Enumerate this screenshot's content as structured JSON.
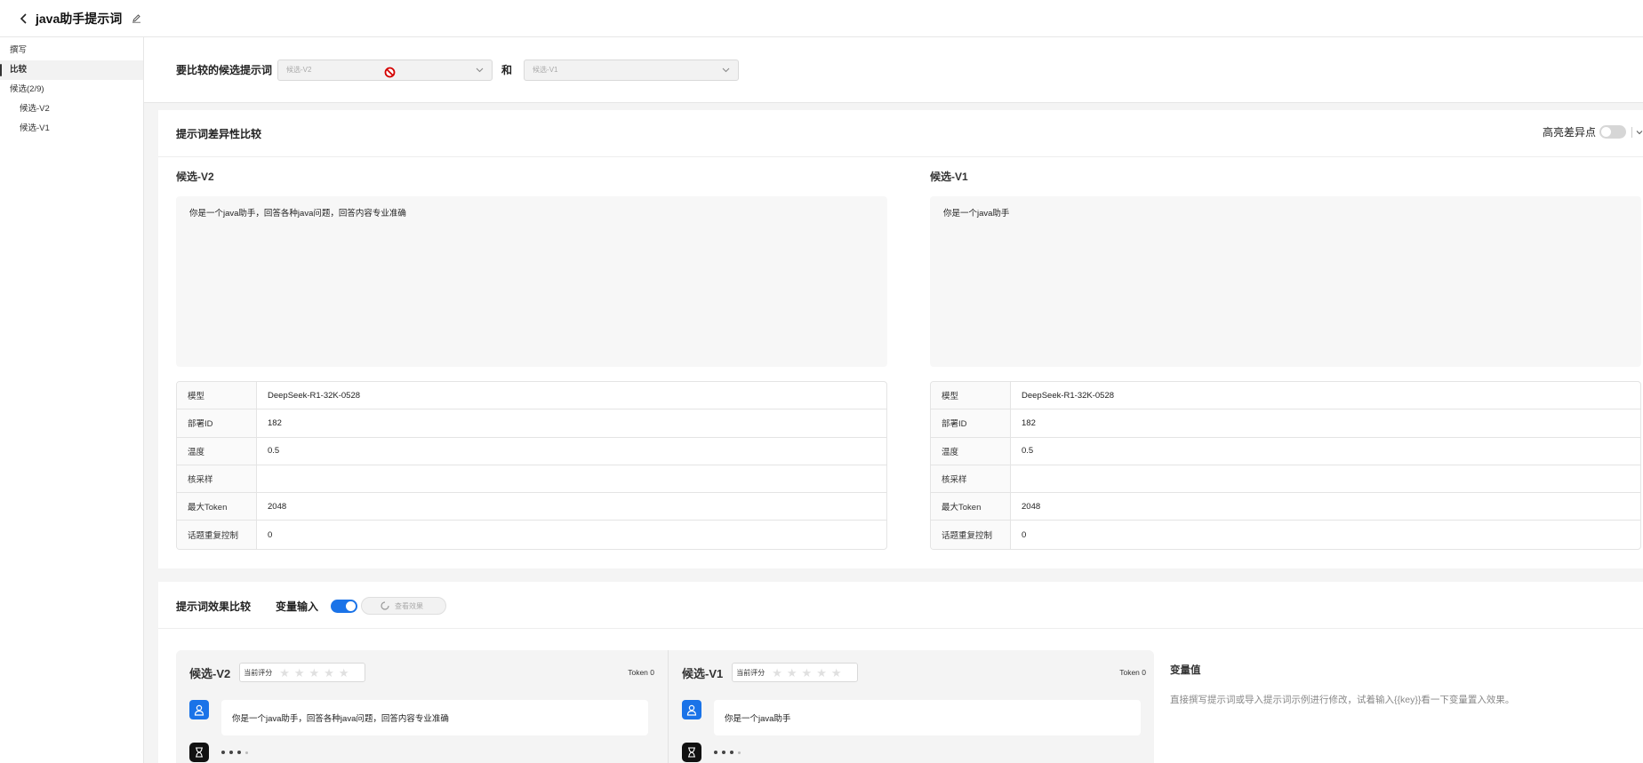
{
  "header": {
    "title": "java助手提示词"
  },
  "sidebar": {
    "items": [
      {
        "label": "撰写"
      },
      {
        "label": "比较"
      },
      {
        "label": "候选(2/9)"
      },
      {
        "label": "候选-V2"
      },
      {
        "label": "候选-V1"
      }
    ],
    "active_index": 1
  },
  "compare_bar": {
    "label": "要比较的候选提示词",
    "select_a": {
      "placeholder": "候选-V2"
    },
    "and_label": "和",
    "select_b": {
      "placeholder": "候选-V1"
    }
  },
  "diff_panel": {
    "title": "提示词差异性比较",
    "highlight_label": "高亮差异点",
    "highlight_on": false,
    "left": {
      "name": "候选-V2",
      "prompt": "你是一个java助手，回答各种java问题，回答内容专业准确",
      "params": [
        {
          "key": "模型",
          "value": "DeepSeek-R1-32K-0528"
        },
        {
          "key": "部署ID",
          "value": "182"
        },
        {
          "key": "温度",
          "value": "0.5"
        },
        {
          "key": "核采样",
          "value": ""
        },
        {
          "key": "最大Token",
          "value": "2048"
        },
        {
          "key": "话题重复控制",
          "value": "0"
        }
      ]
    },
    "right": {
      "name": "候选-V1",
      "prompt": "你是一个java助手",
      "params": [
        {
          "key": "模型",
          "value": "DeepSeek-R1-32K-0528"
        },
        {
          "key": "部署ID",
          "value": "182"
        },
        {
          "key": "温度",
          "value": "0.5"
        },
        {
          "key": "核采样",
          "value": ""
        },
        {
          "key": "最大Token",
          "value": "2048"
        },
        {
          "key": "话题重复控制",
          "value": "0"
        }
      ]
    }
  },
  "effect_panel": {
    "title": "提示词效果比较",
    "var_input_label": "变量输入",
    "var_input_on": true,
    "view_button": "查看效果",
    "candidates": [
      {
        "name": "候选-V2",
        "rating_label": "当前评分",
        "rating": 0,
        "token": "Token 0",
        "user_message": "你是一个java助手，回答各种java问题，回答内容专业准确"
      },
      {
        "name": "候选-V1",
        "rating_label": "当前评分",
        "rating": 0,
        "token": "Token 0",
        "user_message": "你是一个java助手"
      }
    ],
    "variables": {
      "title": "变量值",
      "hint": "直接撰写提示词或导入提示词示例进行修改，试着输入{{key}}看一下变量置入效果。"
    }
  },
  "colors": {
    "accent": "#1a73e8",
    "forbidden": "#d40000"
  },
  "icons": [
    "back-arrow-icon",
    "edit-pencil-icon",
    "chevron-down-icon",
    "forbidden-cursor-icon",
    "loading-spinner-icon",
    "star-icon",
    "user-avatar-icon",
    "hourglass-icon"
  ]
}
